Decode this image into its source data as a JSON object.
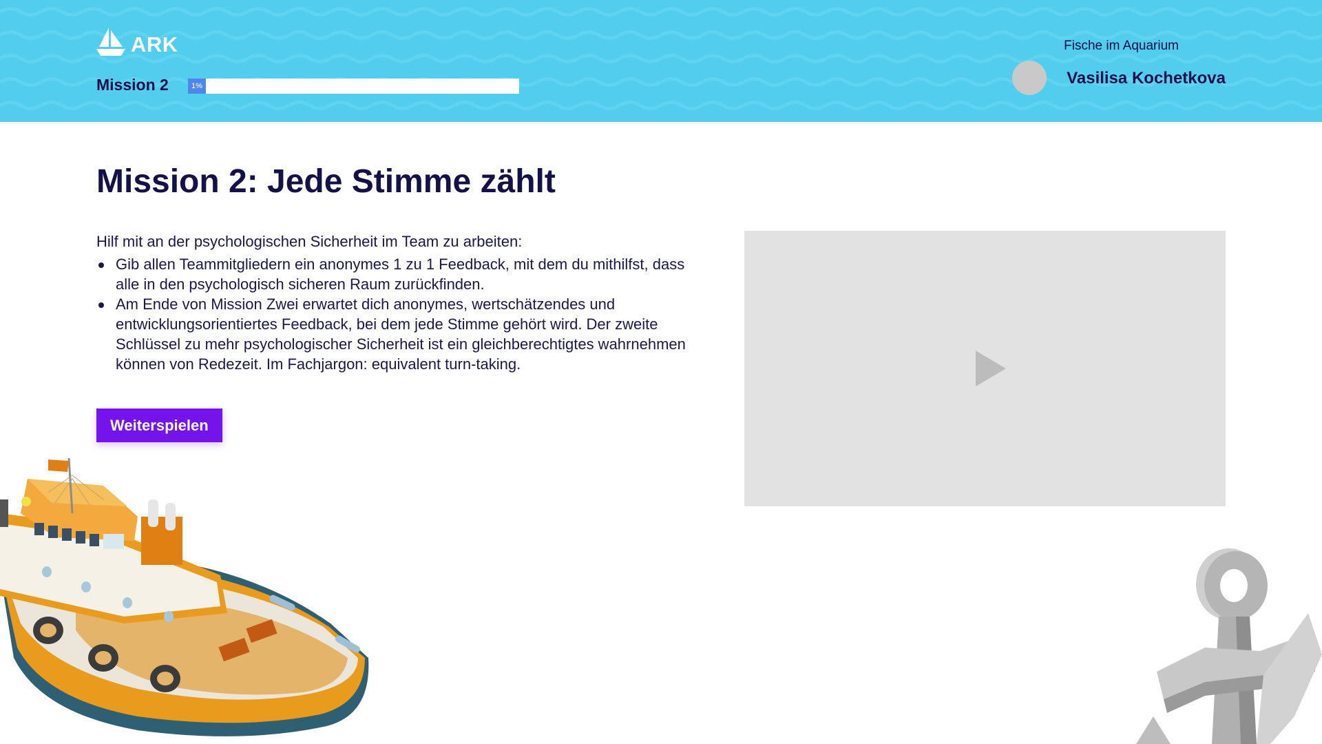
{
  "header": {
    "logo_text": "ARK",
    "mission_label": "Mission 2",
    "progress": {
      "value_percent": 1,
      "label": "1%"
    },
    "team_name": "Fische im Aquarium",
    "user_name": "Vasilisa Kochetkova"
  },
  "main": {
    "title": "Mission 2: Jede Stimme zählt",
    "intro": "Hilf mit an der psychologischen Sicherheit im Team zu arbeiten:",
    "bullets": [
      "Gib allen Teammitgliedern ein anonymes 1 zu 1 Feedback, mit dem du mithilfst, dass alle in den psychologisch sicheren Raum zurückfinden.",
      "Am Ende von Mission Zwei erwartet dich anonymes, wertschätzendes und entwicklungsorientiertes Feedback, bei dem jede Stimme gehört wird. Der zweite Schlüssel zu mehr psychologischer Sicherheit ist ein gleichberechtigtes wahrnehmen können von Redezeit. Im Fachjargon: equivalent turn-taking."
    ],
    "continue_button": "Weiterspielen"
  },
  "video": {
    "icon": "play-icon"
  },
  "illustrations": {
    "boat": "boat-illustration",
    "anchor": "anchor-illustration"
  },
  "colors": {
    "header_bg": "#52cdee",
    "text_dark": "#13104a",
    "button": "#7413eb",
    "progress_fill": "#4f86ea",
    "video_bg": "#e2e2e2"
  }
}
